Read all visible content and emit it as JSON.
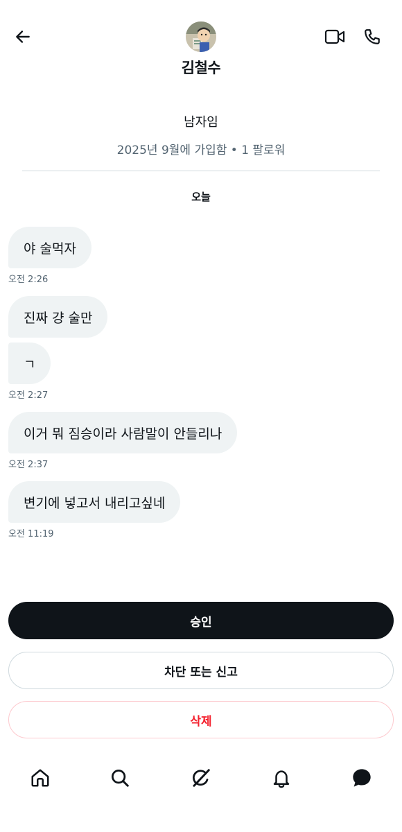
{
  "header": {
    "user_name": "김철수",
    "avatar_alt": "profile-avatar",
    "icons": {
      "back": "arrow-left-icon",
      "video": "video-camera-icon",
      "call": "phone-icon"
    }
  },
  "profile": {
    "bio": "남자임",
    "meta": "2025년 9월에 가입함 • 1 팔로워"
  },
  "date_separator": "오늘",
  "messages": [
    {
      "text": "야 술먹자",
      "time": "오전 2:26"
    },
    {
      "text": "진짜 걍 술만",
      "time": ""
    },
    {
      "text": "ㄱ",
      "time": "오전 2:27"
    },
    {
      "text": "이거 뭐 짐승이라 사람말이 안들리나",
      "time": "오전 2:37"
    },
    {
      "text": "변기에 넣고서 내리고싶네",
      "time": "오전 11:19"
    }
  ],
  "actions": {
    "accept": "승인",
    "block_report": "차단 또는 신고",
    "delete": "삭제"
  },
  "nav": {
    "items": [
      "home-icon",
      "search-icon",
      "grok-icon",
      "bell-icon",
      "messages-icon"
    ]
  },
  "colors": {
    "text": "#0f1419",
    "secondary": "#536471",
    "bubble": "#eff3f4",
    "danger": "#f4212e"
  }
}
